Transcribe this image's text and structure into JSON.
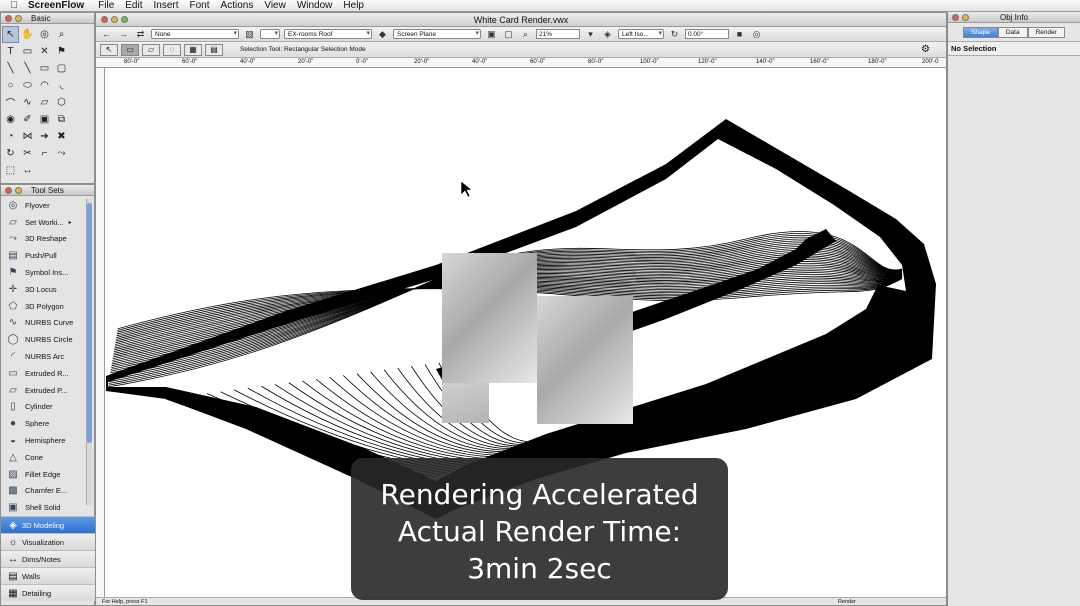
{
  "menubar": {
    "app": "ScreenFlow",
    "items": [
      "File",
      "Edit",
      "Insert",
      "Font",
      "Actions",
      "View",
      "Window",
      "Help"
    ]
  },
  "basic_palette": {
    "title": "Basic"
  },
  "toolsets_palette": {
    "title": "Tool Sets",
    "tools": [
      {
        "label": "Flyover",
        "icon": "flyover-icon"
      },
      {
        "label": "Set Worki...",
        "icon": "working-plane-icon"
      },
      {
        "label": "3D Reshape",
        "icon": "reshape-icon"
      },
      {
        "label": "Push/Pull",
        "icon": "push-pull-icon"
      },
      {
        "label": "Symbol Ins...",
        "icon": "symbol-icon"
      },
      {
        "label": "3D Locus",
        "icon": "locus-icon"
      },
      {
        "label": "3D Polygon",
        "icon": "polygon-icon"
      },
      {
        "label": "NURBS Curve",
        "icon": "nurbs-curve-icon"
      },
      {
        "label": "NURBS Circle",
        "icon": "nurbs-circle-icon"
      },
      {
        "label": "NURBS Arc",
        "icon": "nurbs-arc-icon"
      },
      {
        "label": "Extruded R...",
        "icon": "extrude-rect-icon"
      },
      {
        "label": "Extruded P...",
        "icon": "extrude-poly-icon"
      },
      {
        "label": "Cylinder",
        "icon": "cylinder-icon"
      },
      {
        "label": "Sphere",
        "icon": "sphere-icon"
      },
      {
        "label": "Hemisphere",
        "icon": "hemisphere-icon"
      },
      {
        "label": "Cone",
        "icon": "cone-icon"
      },
      {
        "label": "Fillet Edge",
        "icon": "fillet-icon"
      },
      {
        "label": "Chamfer E...",
        "icon": "chamfer-icon"
      },
      {
        "label": "Shell Solid",
        "icon": "shell-icon"
      }
    ],
    "sets": [
      {
        "label": "3D Modeling",
        "active": true
      },
      {
        "label": "Visualization",
        "active": false
      },
      {
        "label": "Dims/Notes",
        "active": false
      },
      {
        "label": "Walls",
        "active": false
      },
      {
        "label": "Detailing",
        "active": false
      }
    ]
  },
  "document": {
    "title": "White Card Render.vwx",
    "toolbar": {
      "class_select": "None",
      "layer_select": "EX-rooms Roof",
      "plane_select": "Screen Plane",
      "zoom": "21%",
      "view_select": "Left Iso...",
      "rotation": "0.00°"
    },
    "mode_hint": "Selection Tool: Rectangular Selection Mode",
    "ruler_labels": [
      "80'-0\"",
      "60'-0\"",
      "40'-0\"",
      "20'-0\"",
      "0'-0\"",
      "20'-0\"",
      "40'-0\"",
      "60'-0\"",
      "80'-0\"",
      "100'-0\"",
      "120'-0\"",
      "140'-0\"",
      "160'-0\"",
      "180'-0\"",
      "200'-0"
    ],
    "status_left": "For Help, press F1",
    "status_right": "Render"
  },
  "obj_info": {
    "title": "Obj Info",
    "tabs": [
      {
        "label": "Shape",
        "active": true
      },
      {
        "label": "Data",
        "active": false
      },
      {
        "label": "Render",
        "active": false
      }
    ],
    "selection": "No Selection"
  },
  "caption": {
    "line1": "Rendering Accelerated",
    "line2": "Actual Render Time:",
    "line3": "3min 2sec"
  }
}
